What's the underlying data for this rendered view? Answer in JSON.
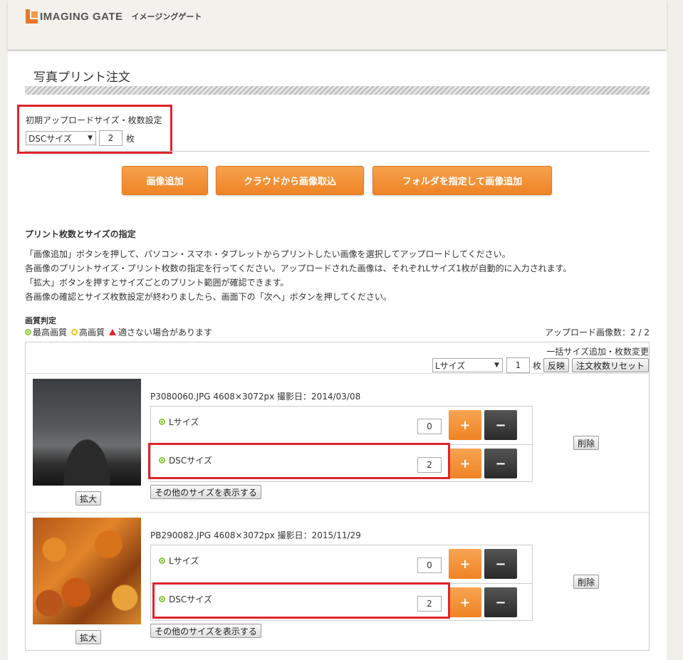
{
  "header": {
    "logo_text": "IMAGING GATE",
    "logo_kana": "イメージングゲート"
  },
  "page_title": "写真プリント注文",
  "initial_settings": {
    "label": "初期アップロードサイズ・枚数設定",
    "size_value": "DSCサイズ",
    "count_value": "2",
    "count_unit": "枚"
  },
  "buttons": {
    "add_image": "画像追加",
    "cloud_import": "クラウドから画像取込",
    "folder_add": "フォルダを指定して画像追加"
  },
  "section": {
    "title": "プリント枚数とサイズの指定",
    "desc_lines": [
      "「画像追加」ボタンを押して、パソコン・スマホ・タブレットからプリントしたい画像を選択してアップロードしてください。",
      "各画像のプリントサイズ・プリント枚数の指定を行ってください。アップロードされた画像は、それぞれLサイズ1枚が自動的に入力されます。",
      "「拡大」ボタンを押すとサイズごとのプリント範囲が確認できます。",
      "各画像の確認とサイズ枚数設定が終わりましたら、画面下の「次へ」ボタンを押してください。"
    ]
  },
  "quality": {
    "title": "画質判定",
    "best": "最高画質",
    "high": "高画質",
    "warn": "適さない場合があります"
  },
  "upload_count": "アップロード画像数：2 / 2",
  "bulk": {
    "title": "一括サイズ追加・枚数変更",
    "size_value": "Lサイズ",
    "count_value": "1",
    "count_unit": "枚",
    "apply_label": "反映",
    "reset_label": "注文枚数リセット"
  },
  "items": [
    {
      "file_info": "P3080060.JPG  4608×3072px  撮影日：2014/03/08",
      "zoom_label": "拡大",
      "other_sizes_label": "その他のサイズを表示する",
      "delete_label": "削除",
      "sizes": [
        {
          "label": "Lサイズ",
          "qty": "0"
        },
        {
          "label": "DSCサイズ",
          "qty": "2"
        }
      ]
    },
    {
      "file_info": "PB290082.JPG  4608×3072px  撮影日：2015/11/29",
      "zoom_label": "拡大",
      "other_sizes_label": "その他のサイズを表示する",
      "delete_label": "削除",
      "sizes": [
        {
          "label": "Lサイズ",
          "qty": "0"
        },
        {
          "label": "DSCサイズ",
          "qty": "2"
        }
      ]
    }
  ],
  "symbols": {
    "plus": "+",
    "minus": "−",
    "dropdown": "▼"
  },
  "colors": {
    "accent_orange": "#ef8426",
    "highlight_red": "#e0242e",
    "dark_button": "#2a2a2a",
    "quality_green": "#7cbf3b"
  }
}
